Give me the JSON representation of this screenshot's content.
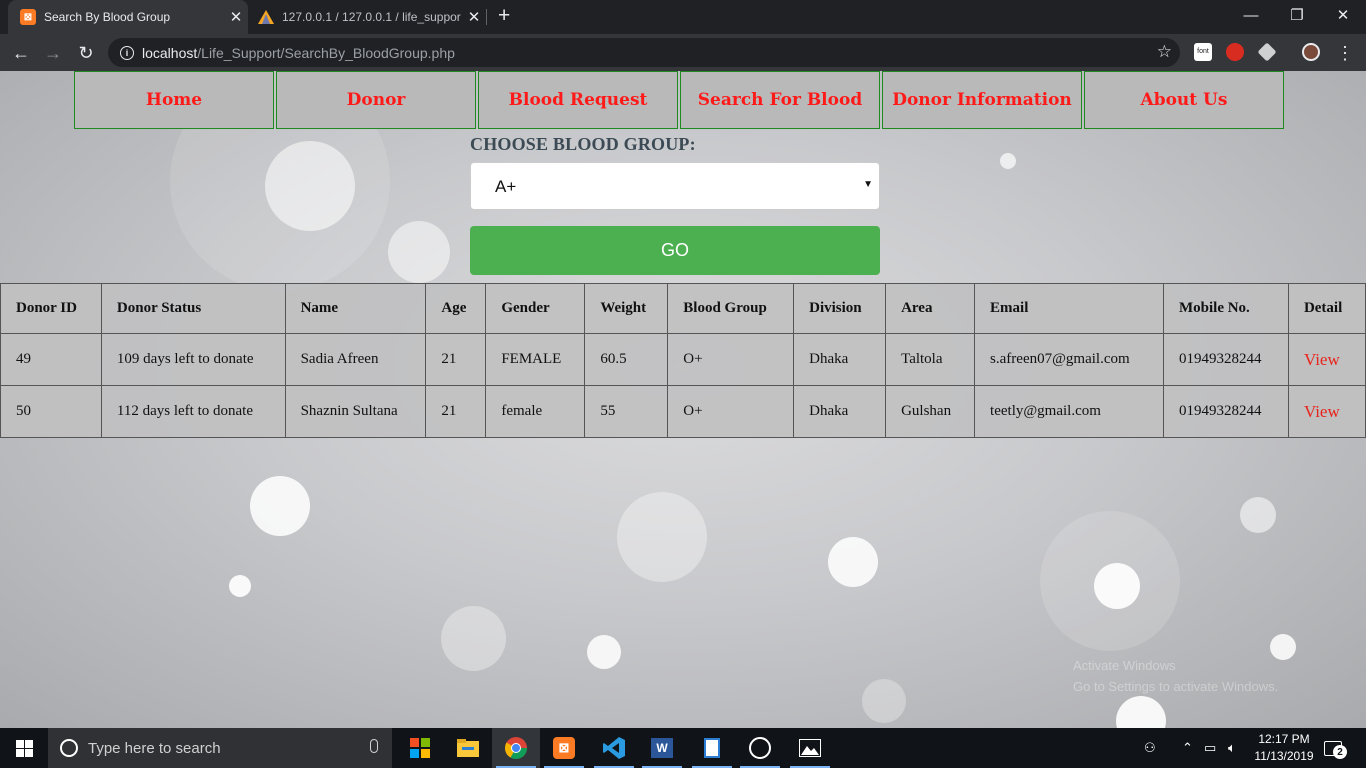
{
  "browser": {
    "tabs": [
      {
        "title": "Search By Blood Group",
        "active": true
      },
      {
        "title": "127.0.0.1 / 127.0.0.1 / life_suppor",
        "active": false
      }
    ],
    "url_host": "localhost",
    "url_path": "/Life_Support/SearchBy_BloodGroup.php",
    "extensions": [
      "font-icon",
      "adblock-icon",
      "cube-icon",
      "profile-avatar"
    ]
  },
  "nav": {
    "items": [
      "Home",
      "Donor",
      "Blood Request",
      "Search For Blood",
      "Donor Information",
      "About Us"
    ]
  },
  "search": {
    "label": "CHOOSE BLOOD GROUP:",
    "selected": "A+",
    "go_label": "GO"
  },
  "table": {
    "headers": [
      "Donor ID",
      "Donor Status",
      "Name",
      "Age",
      "Gender",
      "Weight",
      "Blood Group",
      "Division",
      "Area",
      "Email",
      "Mobile No.",
      "Detail"
    ],
    "rows": [
      [
        "49",
        "109 days left to donate",
        "Sadia Afreen",
        "21",
        "FEMALE",
        "60.5",
        "O+",
        "Dhaka",
        "Taltola",
        "s.afreen07@gmail.com",
        "01949328244",
        "View"
      ],
      [
        "50",
        "112 days left to donate",
        "Shaznin Sultana",
        "21",
        "female",
        "55",
        "O+",
        "Dhaka",
        "Gulshan",
        "teetly@gmail.com",
        "01949328244",
        "View"
      ]
    ]
  },
  "watermark": {
    "line1": "Activate Windows",
    "line2": "Go to Settings to activate Windows."
  },
  "taskbar": {
    "search_placeholder": "Type here to search",
    "apps": [
      "task-view",
      "file-explorer",
      "chrome",
      "xampp",
      "vs-code",
      "word",
      "photos",
      "camera",
      "image-viewer"
    ],
    "time": "12:17 PM",
    "date": "11/13/2019",
    "notification_count": "2"
  },
  "colors": {
    "nav_text": "#ff1a1a",
    "nav_border": "#1f8a1f",
    "go_button": "#4caf50",
    "view_link": "#e8231b"
  }
}
